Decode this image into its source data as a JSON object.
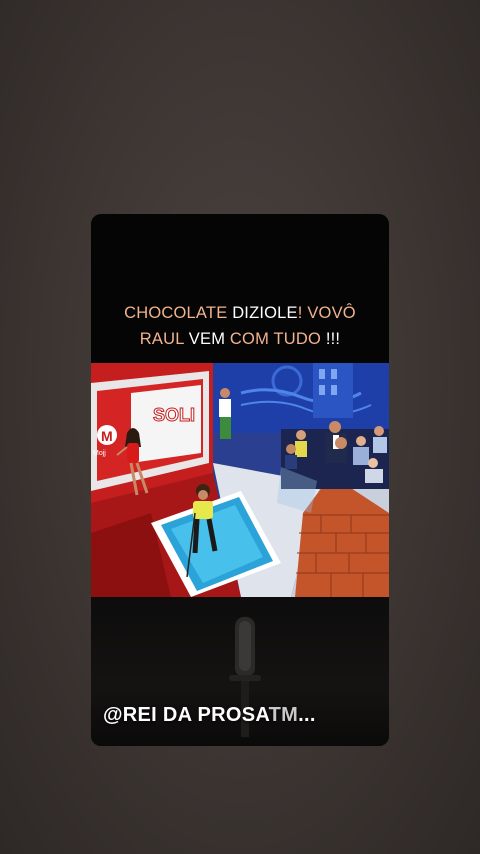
{
  "story": {
    "caption": {
      "line1": [
        {
          "text": "CHOCOLATE ",
          "color": "#f2b38f"
        },
        {
          "text": "DIZIOLE",
          "color": "#ffffff"
        },
        {
          "text": "! VOVÔ",
          "color": "#f2b38f"
        }
      ],
      "line2": [
        {
          "text": "RAUL ",
          "color": "#f2b38f"
        },
        {
          "text": "VEM ",
          "color": "#ffffff"
        },
        {
          "text": "COM TUDO ",
          "color": "#f2b38f"
        },
        {
          "text": "!!!",
          "color": "#ffffff"
        }
      ]
    },
    "video": {
      "set_logo_letter": "M",
      "set_logo_text": "Mojj"
    },
    "watermark": {
      "handle": "@REI DA PROSA",
      "suffix": "TM...",
      "tm": "TM",
      "ellipsis": "..."
    }
  },
  "colors": {
    "background": "#3f3936",
    "card": "#050505",
    "caption_accent": "#f2b38f",
    "caption_white": "#ffffff"
  }
}
